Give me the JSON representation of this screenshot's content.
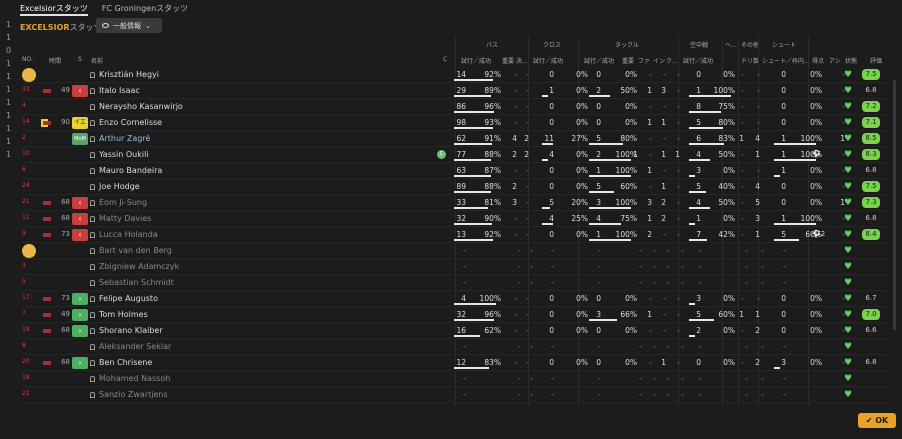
{
  "tabs": [
    {
      "label": "Excelsiorスタッツ",
      "active": true
    },
    {
      "label": "FC Groningenスタッツ",
      "active": false
    }
  ],
  "team_title": "EXCELSIOR",
  "team_title_suffix": "スタッツ",
  "view_dropdown": "一般情報",
  "left_numbers": [
    "1",
    "1",
    "0",
    "1",
    "1",
    "1",
    "1",
    "1",
    "1",
    "1",
    "1"
  ],
  "group_headers": {
    "pass": "パス",
    "cross": "クロス",
    "tackle": "タックル",
    "aerial": "空中戦",
    "he": "ヘ...",
    "other": "その他",
    "shoot": "シュート"
  },
  "col_headers": {
    "no": "NO.",
    "time": "時間",
    "s": "S",
    "name": "名前",
    "c": "C",
    "pass_att": "試行／成功",
    "imp": "重要",
    "ke": "決...",
    "cross_att": "試行／成功",
    "tackle_att": "試行／成功",
    "tackle_imp": "重要",
    "fa": "ファ",
    "in": "イン",
    "ku": "ク...",
    "aerial_att": "試行／成功",
    "dribble": "ドリ数",
    "shot_att": "シュート／枠内...",
    "goals": "得点",
    "assist": "アシ",
    "status": "状態",
    "rating": "評価"
  },
  "players": [
    {
      "no": "",
      "time": "",
      "badge": "",
      "name": "Krisztián Hegyi",
      "avatar": true,
      "pass": [
        "14",
        "92%"
      ],
      "pi": "-",
      "pk": "-",
      "cross": [
        "0",
        "0%"
      ],
      "tack": [
        "0",
        "0%"
      ],
      "ti": "-",
      "fa": "-",
      "inn": "-",
      "ku": "-",
      "aer": [
        "0",
        "0%"
      ],
      "he": "-",
      "dr": "-",
      "shot": [
        "0",
        "0%"
      ],
      "g": "",
      "a": "-",
      "rating": "7.5",
      "rg": true
    },
    {
      "no": "33",
      "time": "49",
      "badge": "out",
      "name": "Italo Isaac",
      "pass": [
        "29",
        "89%"
      ],
      "pi": "-",
      "pk": "-",
      "cross": [
        "1",
        "0%"
      ],
      "tack": [
        "2",
        "50%"
      ],
      "ti": "-",
      "fa": "1",
      "inn": "3",
      "ku": "-",
      "aer": [
        "1",
        "100%"
      ],
      "he": "-",
      "dr": "-",
      "shot": [
        "0",
        "0%"
      ],
      "g": "",
      "a": "-",
      "rating": "6.8",
      "rg": false
    },
    {
      "no": "4",
      "time": "",
      "badge": "",
      "name": "Neraysho Kasanwirjo",
      "pass": [
        "86",
        "96%"
      ],
      "pi": "-",
      "pk": "-",
      "cross": [
        "0",
        "0%"
      ],
      "tack": [
        "0",
        "0%"
      ],
      "ti": "-",
      "fa": "-",
      "inn": "-",
      "ku": "-",
      "aer": [
        "8",
        "75%"
      ],
      "he": "-",
      "dr": "-",
      "shot": [
        "0",
        "0%"
      ],
      "g": "",
      "a": "-",
      "rating": "7.2",
      "rg": true
    },
    {
      "no": "14",
      "time": "90",
      "badge": "yellowbox",
      "card": true,
      "name": "Enzo Cornelisse",
      "pass": [
        "98",
        "93%"
      ],
      "pi": "-",
      "pk": "-",
      "cross": [
        "0",
        "0%"
      ],
      "tack": [
        "0",
        "0%"
      ],
      "ti": "-",
      "fa": "1",
      "inn": "1",
      "ku": "-",
      "aer": [
        "5",
        "80%"
      ],
      "he": "-",
      "dr": "-",
      "shot": [
        "0",
        "0%"
      ],
      "g": "",
      "a": "-",
      "rating": "7.1",
      "rg": true
    },
    {
      "no": "2",
      "time": "",
      "badge": "motm",
      "name": "Arthur Zagré",
      "link": true,
      "pass": [
        "62",
        "91%"
      ],
      "pi": "4",
      "pk": "2",
      "cross": [
        "11",
        "27%"
      ],
      "tack": [
        "5",
        "80%"
      ],
      "ti": "-",
      "fa": "-",
      "inn": "-",
      "ku": "-",
      "aer": [
        "6",
        "83%"
      ],
      "he": "1",
      "dr": "4",
      "shot": [
        "1",
        "100%"
      ],
      "g": "",
      "a": "1",
      "rating": "8.5",
      "rg": true
    },
    {
      "no": "10",
      "time": "",
      "badge": "",
      "name": "Yassin Oukili",
      "mot": true,
      "pass": [
        "77",
        "88%"
      ],
      "pi": "2",
      "pk": "2",
      "cross": [
        "4",
        "0%"
      ],
      "tack": [
        "2",
        "100%"
      ],
      "ti": "1",
      "fa": "-",
      "inn": "1",
      "ku": "1",
      "aer": [
        "4",
        "50%"
      ],
      "he": "-",
      "dr": "1",
      "shot": [
        "1",
        "100%"
      ],
      "g": "⚽",
      "a": "-",
      "rating": "8.3",
      "rg": true
    },
    {
      "no": "6",
      "time": "",
      "badge": "",
      "name": "Mauro Bandeira",
      "pass": [
        "63",
        "87%"
      ],
      "pi": "-",
      "pk": "-",
      "cross": [
        "0",
        "0%"
      ],
      "tack": [
        "1",
        "100%"
      ],
      "ti": "-",
      "fa": "1",
      "inn": "-",
      "ku": "-",
      "aer": [
        "3",
        "0%"
      ],
      "he": "-",
      "dr": "-",
      "shot": [
        "1",
        "0%"
      ],
      "g": "",
      "a": "-",
      "rating": "6.8",
      "rg": false
    },
    {
      "no": "24",
      "time": "",
      "badge": "",
      "name": "Joe Hodge",
      "pass": [
        "89",
        "88%"
      ],
      "pi": "2",
      "pk": "-",
      "cross": [
        "0",
        "0%"
      ],
      "tack": [
        "5",
        "60%"
      ],
      "ti": "-",
      "fa": "-",
      "inn": "1",
      "ku": "-",
      "aer": [
        "5",
        "40%"
      ],
      "he": "-",
      "dr": "4",
      "shot": [
        "0",
        "0%"
      ],
      "g": "",
      "a": "-",
      "rating": "7.5",
      "rg": true
    },
    {
      "no": "21",
      "time": "68",
      "badge": "out",
      "name": "Eom Ji-Sung",
      "dim": true,
      "pass": [
        "33",
        "81%"
      ],
      "pi": "3",
      "pk": "-",
      "cross": [
        "5",
        "20%"
      ],
      "tack": [
        "3",
        "100%"
      ],
      "ti": "-",
      "fa": "3",
      "inn": "2",
      "ku": "-",
      "aer": [
        "4",
        "50%"
      ],
      "he": "-",
      "dr": "5",
      "shot": [
        "0",
        "0%"
      ],
      "g": "",
      "a": "1",
      "rating": "7.3",
      "rg": true
    },
    {
      "no": "11",
      "time": "68",
      "badge": "out",
      "name": "Matty Davies",
      "dim": true,
      "pass": [
        "32",
        "90%"
      ],
      "pi": "-",
      "pk": "-",
      "cross": [
        "4",
        "25%"
      ],
      "tack": [
        "4",
        "75%"
      ],
      "ti": "-",
      "fa": "1",
      "inn": "2",
      "ku": "-",
      "aer": [
        "1",
        "0%"
      ],
      "he": "-",
      "dr": "3",
      "shot": [
        "1",
        "100%"
      ],
      "g": "",
      "a": "-",
      "rating": "6.8",
      "rg": false
    },
    {
      "no": "9",
      "time": "73",
      "badge": "out",
      "name": "Lucca Holanda",
      "dim": true,
      "pass": [
        "13",
        "92%"
      ],
      "pi": "-",
      "pk": "-",
      "cross": [
        "0",
        "0%"
      ],
      "tack": [
        "1",
        "100%"
      ],
      "ti": "-",
      "fa": "2",
      "inn": "-",
      "ku": "-",
      "aer": [
        "7",
        "42%"
      ],
      "he": "-",
      "dr": "1",
      "shot": [
        "5",
        "60%"
      ],
      "g": "⚽2",
      "a": "-",
      "rating": "8.4",
      "rg": true
    },
    {
      "no": "",
      "time": "",
      "badge": "",
      "name": "Bart van den Berg",
      "dim": true,
      "avatar": true,
      "empty": true
    },
    {
      "no": "3",
      "time": "",
      "badge": "",
      "name": "Zbigniew Adamczyk",
      "dim": true,
      "empty": true
    },
    {
      "no": "5",
      "time": "",
      "badge": "",
      "name": "Sebastian Schmidt",
      "dim": true,
      "empty": true
    },
    {
      "no": "17",
      "time": "73",
      "badge": "in",
      "name": "Felipe Augusto",
      "pass": [
        "4",
        "100%"
      ],
      "pi": "-",
      "pk": "-",
      "cross": [
        "0",
        "0%"
      ],
      "tack": [
        "0",
        "0%"
      ],
      "ti": "-",
      "fa": "-",
      "inn": "-",
      "ku": "-",
      "aer": [
        "3",
        "0%"
      ],
      "he": "-",
      "dr": "-",
      "shot": [
        "0",
        "0%"
      ],
      "g": "",
      "a": "-",
      "rating": "6.7",
      "rg": false
    },
    {
      "no": "7",
      "time": "49",
      "badge": "in",
      "name": "Tom Holmes",
      "pass": [
        "32",
        "96%"
      ],
      "pi": "-",
      "pk": "-",
      "cross": [
        "0",
        "0%"
      ],
      "tack": [
        "3",
        "66%"
      ],
      "ti": "-",
      "fa": "1",
      "inn": "-",
      "ku": "-",
      "aer": [
        "5",
        "60%"
      ],
      "he": "1",
      "dr": "1",
      "shot": [
        "0",
        "0%"
      ],
      "g": "",
      "a": "-",
      "rating": "7.0",
      "rg": true
    },
    {
      "no": "19",
      "time": "68",
      "badge": "in",
      "name": "Shorano Klaiber",
      "pass": [
        "16",
        "62%"
      ],
      "pi": "-",
      "pk": "-",
      "cross": [
        "0",
        "0%"
      ],
      "tack": [
        "0",
        "0%"
      ],
      "ti": "-",
      "fa": "-",
      "inn": "-",
      "ku": "-",
      "aer": [
        "2",
        "0%"
      ],
      "he": "-",
      "dr": "2",
      "shot": [
        "0",
        "0%"
      ],
      "g": "",
      "a": "-",
      "rating": "6.6",
      "rg": false
    },
    {
      "no": "8",
      "time": "",
      "badge": "",
      "name": "Aleksander Seklar",
      "dim": true,
      "empty": true
    },
    {
      "no": "20",
      "time": "68",
      "badge": "in",
      "name": "Ben Chrisene",
      "pass": [
        "12",
        "83%"
      ],
      "pi": "-",
      "pk": "-",
      "cross": [
        "0",
        "0%"
      ],
      "tack": [
        "0",
        "0%"
      ],
      "ti": "-",
      "fa": "-",
      "inn": "1",
      "ku": "-",
      "aer": [
        "0",
        "0%"
      ],
      "he": "-",
      "dr": "2",
      "shot": [
        "3",
        "0%"
      ],
      "g": "",
      "a": "-",
      "rating": "6.8",
      "rg": false
    },
    {
      "no": "18",
      "time": "",
      "badge": "",
      "name": "Mohamed Nassoh",
      "dim": true,
      "empty": true
    },
    {
      "no": "22",
      "time": "",
      "badge": "",
      "name": "Sanzio Zwartjens",
      "dim": true,
      "empty": true
    }
  ],
  "ok_label": "OK"
}
